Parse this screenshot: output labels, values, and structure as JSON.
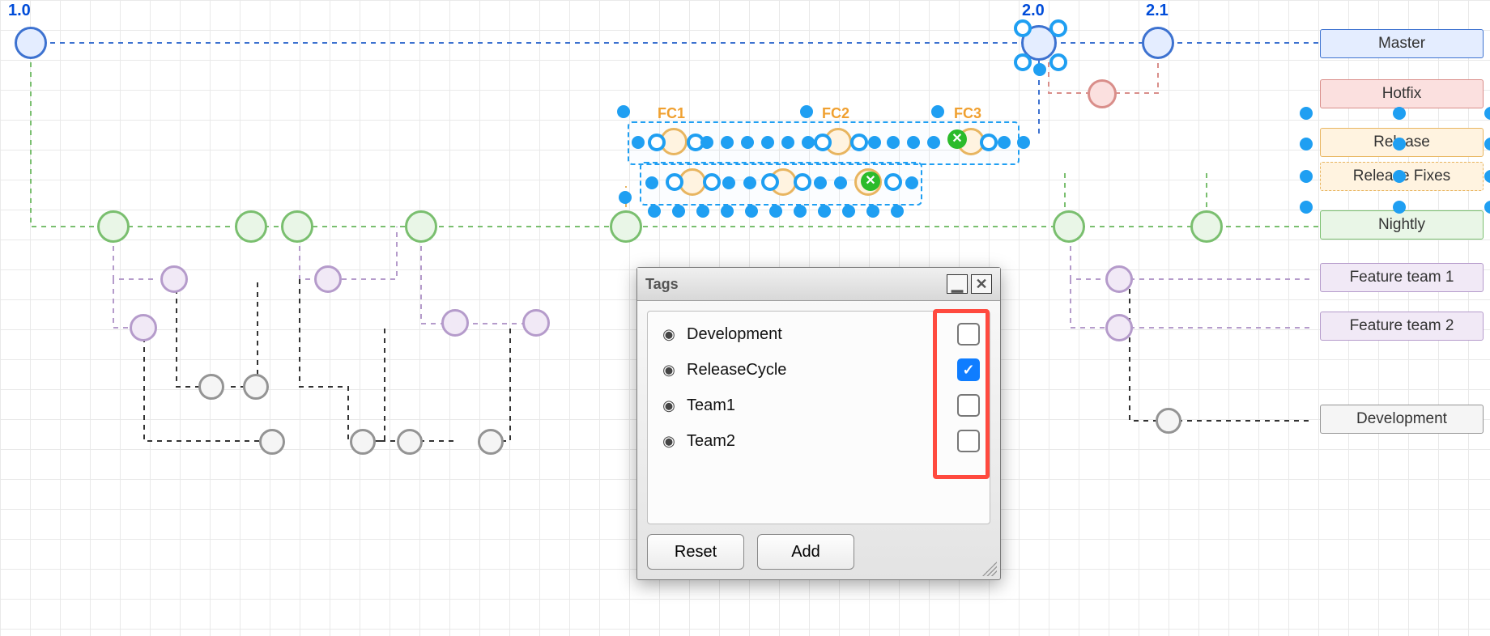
{
  "versions": {
    "v1": "1.0",
    "v2": "2.0",
    "v3": "2.1"
  },
  "feature_labels": {
    "f1": "FC1",
    "f2": "FC2",
    "f3": "FC3"
  },
  "legend": {
    "master": "Master",
    "hotfix": "Hotfix",
    "release": "Release",
    "release_fixes": "Release Fixes",
    "nightly": "Nightly",
    "feature_team_1": "Feature team 1",
    "feature_team_2": "Feature team 2",
    "development": "Development"
  },
  "tags_panel": {
    "title": "Tags",
    "items": [
      {
        "label": "Development",
        "checked": false
      },
      {
        "label": "ReleaseCycle",
        "checked": true
      },
      {
        "label": "Team1",
        "checked": false
      },
      {
        "label": "Team2",
        "checked": false
      }
    ],
    "reset_label": "Reset",
    "add_label": "Add"
  }
}
